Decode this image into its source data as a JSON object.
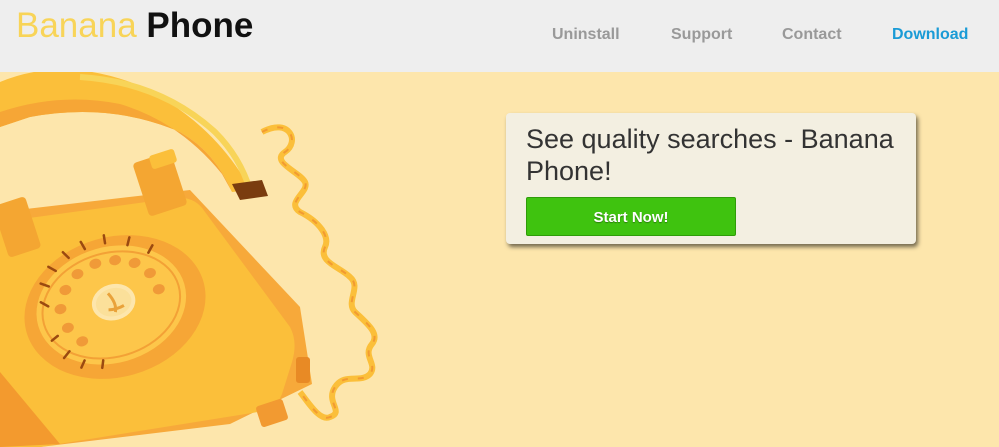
{
  "header": {
    "logo_part1": "Banana",
    "logo_part2": "Phone",
    "nav": [
      {
        "label": "Uninstall"
      },
      {
        "label": "Support"
      },
      {
        "label": "Contact"
      },
      {
        "label": "Download",
        "active": true
      }
    ]
  },
  "hero": {
    "headline": "See quality searches - Banana Phone!",
    "cta_label": "Start Now!"
  },
  "colors": {
    "header_bg": "#eeeeee",
    "hero_bg": "#fde6ac",
    "logo_accent": "#f8d458",
    "nav_active": "#1a9bd6",
    "cta_green": "#3fc30f"
  },
  "icons": [
    "banana-phone-illustration",
    "banana-handset-icon",
    "telephone-cord-icon",
    "rotary-dial-icon"
  ]
}
